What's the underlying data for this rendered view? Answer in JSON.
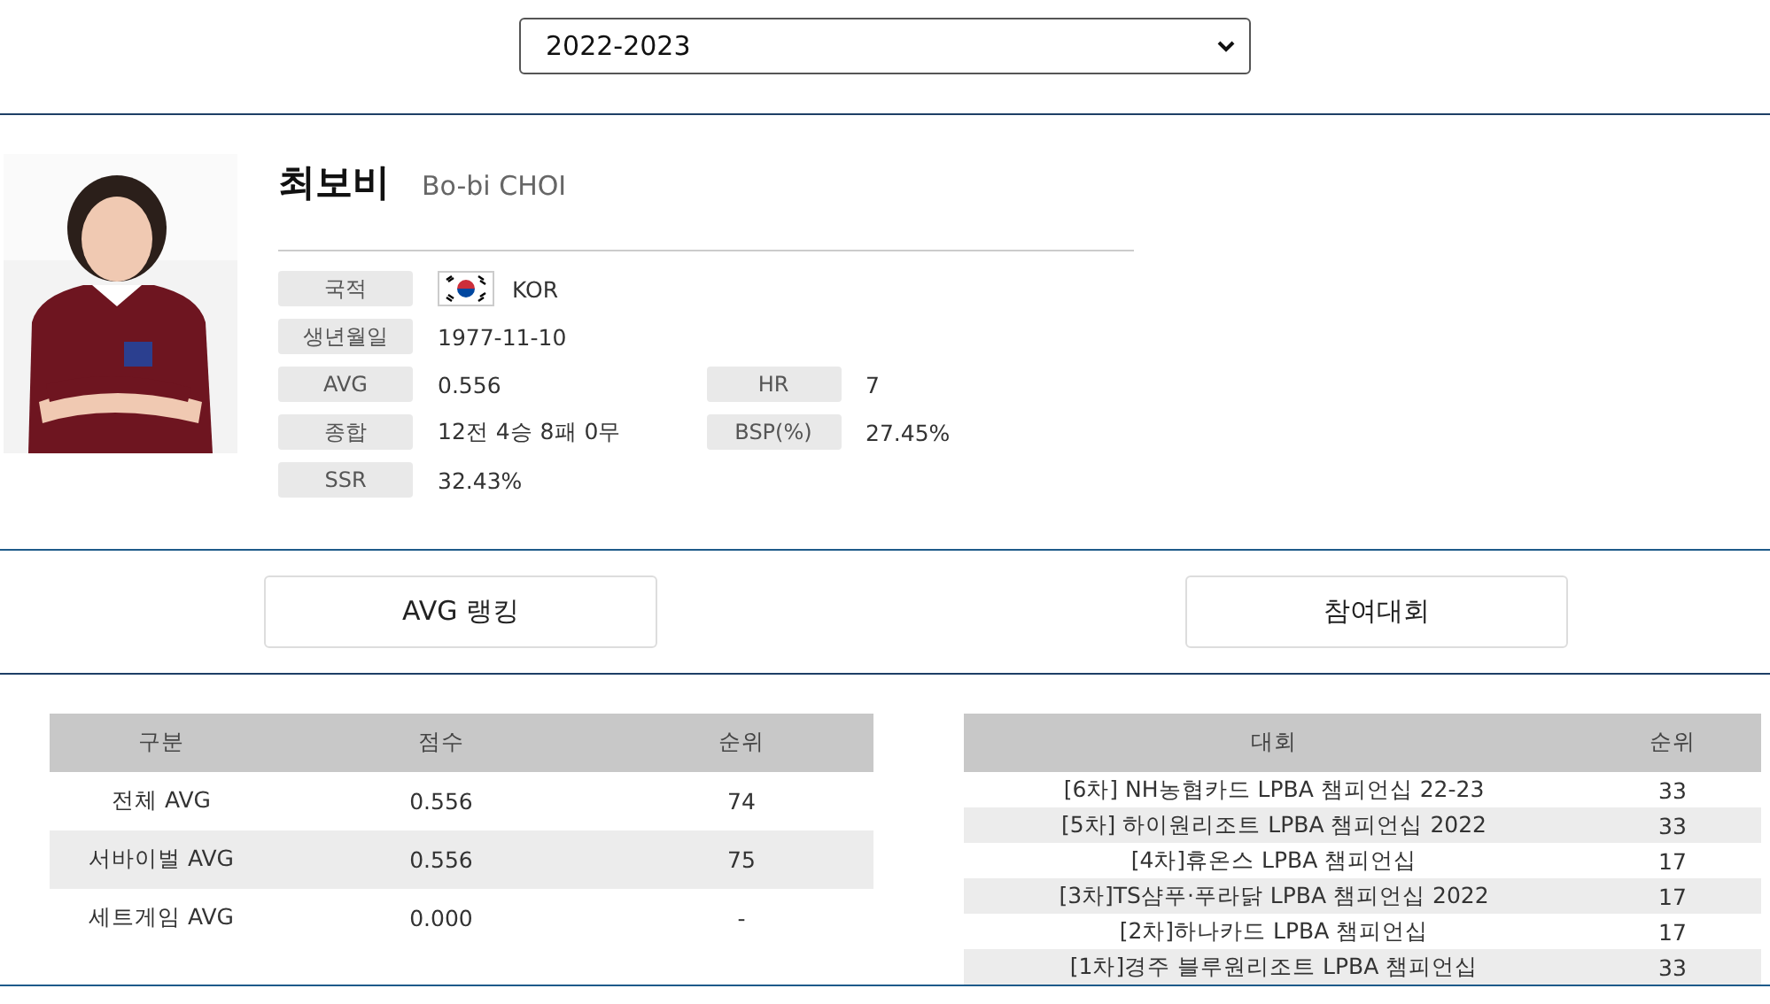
{
  "season_select": {
    "value": "2022-2023"
  },
  "player": {
    "name_ko": "최보비",
    "name_en": "Bo-bi CHOI",
    "info_rows": [
      {
        "cells": [
          {
            "label": "국적",
            "value": "KOR",
            "flag": true
          }
        ]
      },
      {
        "cells": [
          {
            "label": "생년월일",
            "value": "1977-11-10",
            "flag": false
          }
        ]
      },
      {
        "cells": [
          {
            "label": "AVG",
            "value": "0.556",
            "flag": false
          },
          {
            "label": "HR",
            "value": "7",
            "flag": false
          }
        ]
      },
      {
        "cells": [
          {
            "label": "종합",
            "value": "12전 4승 8패 0무",
            "flag": false
          },
          {
            "label": "BSP(%)",
            "value": "27.45%",
            "flag": false
          }
        ]
      },
      {
        "cells": [
          {
            "label": "SSR",
            "value": "32.43%",
            "flag": false
          }
        ]
      }
    ]
  },
  "section_buttons": [
    "AVG 랭킹",
    "참여대회"
  ],
  "ranking_table": {
    "columns": [
      "구분",
      "점수",
      "순위"
    ],
    "rows": [
      [
        "전체 AVG",
        "0.556",
        "74"
      ],
      [
        "서바이벌 AVG",
        "0.556",
        "75"
      ],
      [
        "세트게임 AVG",
        "0.000",
        "-"
      ]
    ]
  },
  "tournament_table": {
    "columns": [
      "대회",
      "순위"
    ],
    "rows": [
      [
        "[6차] NH농협카드 LPBA 챔피언십 22-23",
        "33"
      ],
      [
        "[5차] 하이원리조트 LPBA 챔피언십 2022",
        "33"
      ],
      [
        "[4차]휴온스 LPBA 챔피언십",
        "17"
      ],
      [
        "[3차]TS샴푸·푸라닭 LPBA 챔피언십 2022",
        "17"
      ],
      [
        "[2차]하나카드 LPBA 챔피언십",
        "17"
      ],
      [
        "[1차]경주 블루원리조트 LPBA 챔피언십",
        "33"
      ]
    ]
  }
}
